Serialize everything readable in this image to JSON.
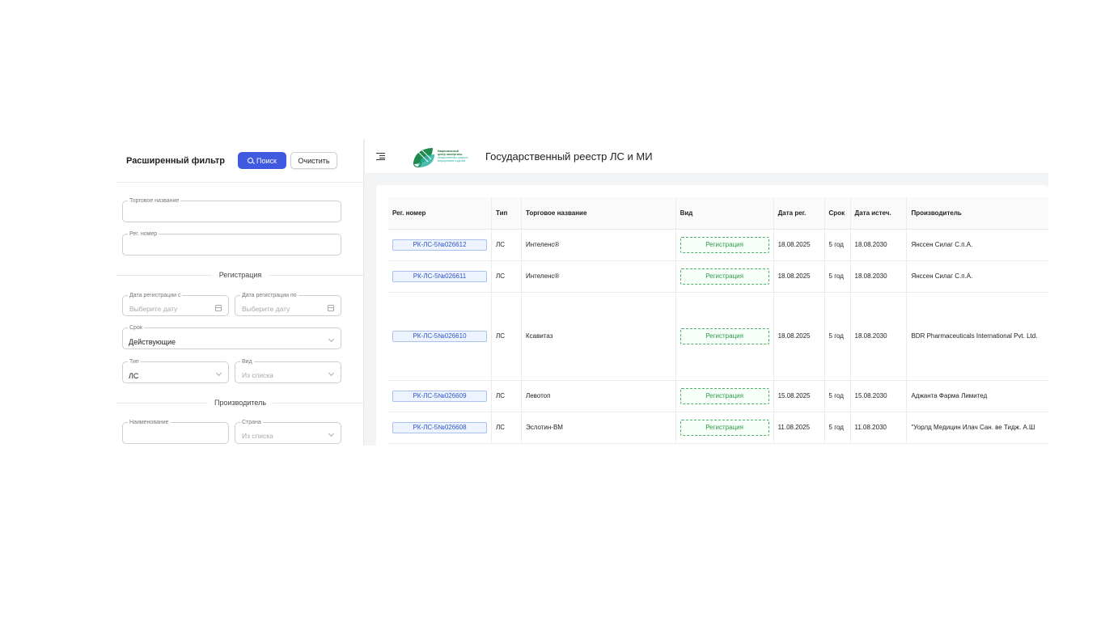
{
  "sidebar": {
    "title": "Расширенный фильтр",
    "search_label": "Поиск",
    "clear_label": "Очистить",
    "trade_name": {
      "legend": "Торговое название",
      "value": ""
    },
    "reg_number": {
      "legend": "Рег. номер",
      "value": ""
    },
    "section_registration": "Регистрация",
    "date_from": {
      "legend": "Дата регистрации с",
      "placeholder": "Выберите дату"
    },
    "date_to": {
      "legend": "Дата регистрации по",
      "placeholder": "Выберите дату"
    },
    "term": {
      "legend": "Срок",
      "value": "Действующие"
    },
    "type": {
      "legend": "Тип",
      "value": "ЛС"
    },
    "kind": {
      "legend": "Вид",
      "placeholder": "Из списка"
    },
    "section_manufacturer": "Производитель",
    "mfr_name": {
      "legend": "Наименование",
      "value": ""
    },
    "country": {
      "legend": "Страна",
      "placeholder": "Из списка"
    }
  },
  "header": {
    "logo_lines": [
      "Национальный",
      "центр экспертизы",
      "лекарственных средств",
      "медицинских изделий"
    ],
    "title": "Государственный реестр ЛС и МИ"
  },
  "table": {
    "columns": [
      "Рег. номер",
      "Тип",
      "Торговое название",
      "Вид",
      "Дата рег.",
      "Срок",
      "Дата истеч.",
      "Производитель"
    ],
    "rows": [
      {
        "reg": "РК-ЛС-5№026612",
        "type": "ЛС",
        "name": "Интеленс®",
        "kind": "Регистрация",
        "date": "18.08.2025",
        "term": "5 год",
        "expiry": "18.08.2030",
        "mfr": "Янссен Силаг С.п.А."
      },
      {
        "reg": "РК-ЛС-5№026611",
        "type": "ЛС",
        "name": "Интеленс®",
        "kind": "Регистрация",
        "date": "18.08.2025",
        "term": "5 год",
        "expiry": "18.08.2030",
        "mfr": "Янссен Силаг С.п.А."
      },
      {
        "reg": "РК-ЛС-5№026610",
        "type": "ЛС",
        "name": "Ксавитаз",
        "kind": "Регистрация",
        "date": "18.08.2025",
        "term": "5 год",
        "expiry": "18.08.2030",
        "mfr": "BDR Pharmaceuticals International Pvt. Ltd."
      },
      {
        "reg": "РК-ЛС-5№026609",
        "type": "ЛС",
        "name": "Левотоп",
        "kind": "Регистрация",
        "date": "15.08.2025",
        "term": "5 год",
        "expiry": "15.08.2030",
        "mfr": "Аджанта Фарма Лимитед"
      },
      {
        "reg": "РК-ЛС-5№026608",
        "type": "ЛС",
        "name": "Эслотин-ВМ",
        "kind": "Регистрация",
        "date": "11.08.2025",
        "term": "5 год",
        "expiry": "11.08.2030",
        "mfr": "\"Уорлд Медицин Илач Сан. ве Тидж. А.Ш"
      }
    ]
  },
  "colors": {
    "primary": "#3f5ae0",
    "reg_tag": "#2d55c4",
    "kind_tag": "#2e9b4c",
    "logo_green": "#1f8a4c"
  }
}
